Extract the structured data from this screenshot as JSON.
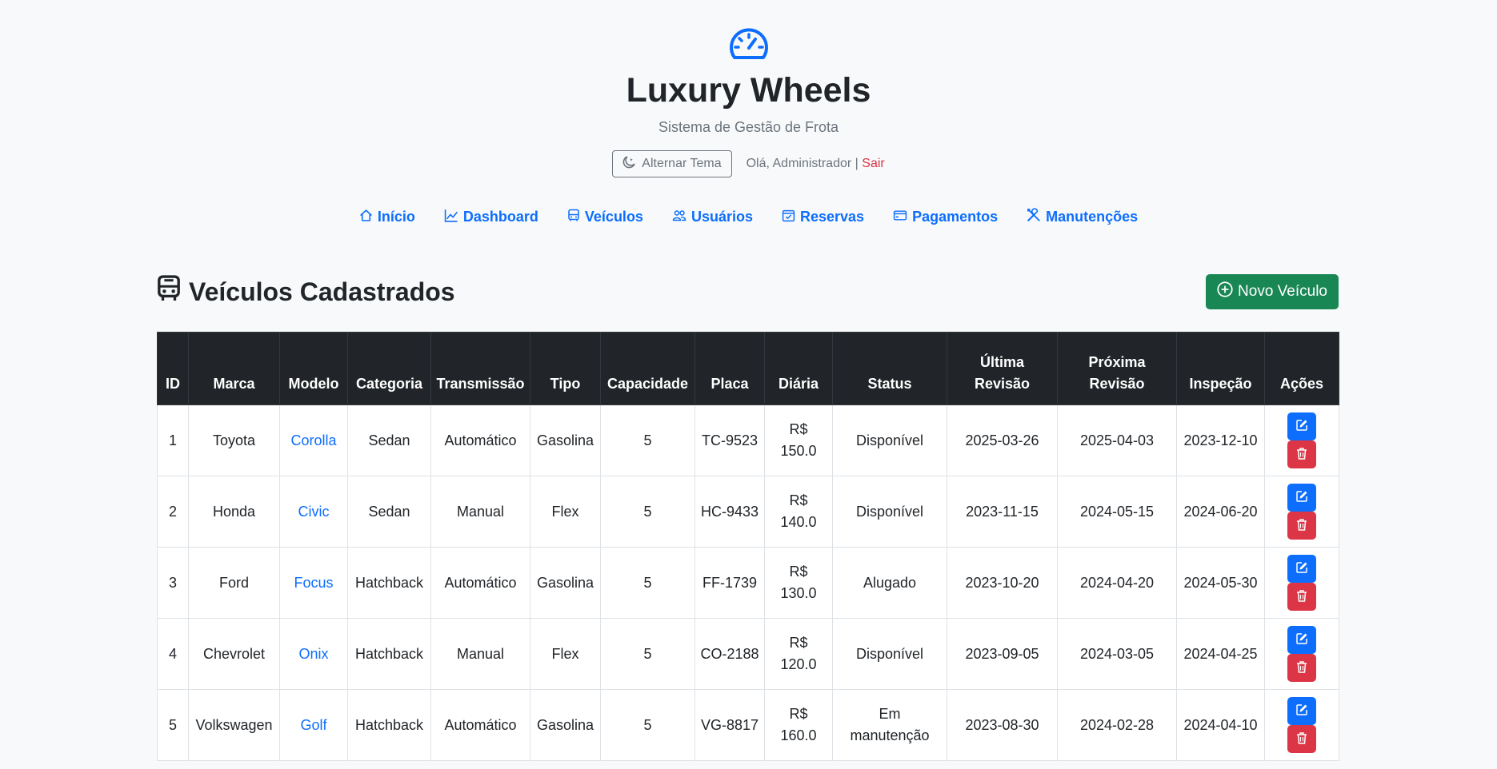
{
  "app": {
    "title": "Luxury Wheels",
    "subtitle": "Sistema de Gestão de Frota",
    "theme_toggle": "Alternar Tema",
    "greeting": "Olá, Administrador",
    "separator": "|",
    "logout": "Sair",
    "logo_icon": "speedometer-icon"
  },
  "nav": [
    {
      "label": "Início",
      "icon": "house-icon"
    },
    {
      "label": "Dashboard",
      "icon": "graph-icon"
    },
    {
      "label": "Veículos",
      "icon": "bus-icon"
    },
    {
      "label": "Usuários",
      "icon": "people-icon"
    },
    {
      "label": "Reservas",
      "icon": "calendar-check-icon"
    },
    {
      "label": "Pagamentos",
      "icon": "credit-card-icon"
    },
    {
      "label": "Manutenções",
      "icon": "tools-icon"
    }
  ],
  "page": {
    "title": "Veículos Cadastrados",
    "new_button": "Novo Veículo"
  },
  "table": {
    "columns": [
      "ID",
      "Marca",
      "Modelo",
      "Categoria",
      "Transmissão",
      "Tipo",
      "Capacidade",
      "Placa",
      "Diária",
      "Status",
      "Última Revisão",
      "Próxima Revisão",
      "Inspeção",
      "Ações"
    ],
    "rows": [
      {
        "id": "1",
        "marca": "Toyota",
        "modelo": "Corolla",
        "categoria": "Sedan",
        "transmissao": "Automático",
        "tipo": "Gasolina",
        "capacidade": "5",
        "placa": "TC-9523",
        "diaria": "R$ 150.0",
        "status": "Disponível",
        "ultima": "2025-03-26",
        "proxima": "2025-04-03",
        "inspecao": "2023-12-10"
      },
      {
        "id": "2",
        "marca": "Honda",
        "modelo": "Civic",
        "categoria": "Sedan",
        "transmissao": "Manual",
        "tipo": "Flex",
        "capacidade": "5",
        "placa": "HC-9433",
        "diaria": "R$ 140.0",
        "status": "Disponível",
        "ultima": "2023-11-15",
        "proxima": "2024-05-15",
        "inspecao": "2024-06-20"
      },
      {
        "id": "3",
        "marca": "Ford",
        "modelo": "Focus",
        "categoria": "Hatchback",
        "transmissao": "Automático",
        "tipo": "Gasolina",
        "capacidade": "5",
        "placa": "FF-1739",
        "diaria": "R$ 130.0",
        "status": "Alugado",
        "ultima": "2023-10-20",
        "proxima": "2024-04-20",
        "inspecao": "2024-05-30"
      },
      {
        "id": "4",
        "marca": "Chevrolet",
        "modelo": "Onix",
        "categoria": "Hatchback",
        "transmissao": "Manual",
        "tipo": "Flex",
        "capacidade": "5",
        "placa": "CO-2188",
        "diaria": "R$ 120.0",
        "status": "Disponível",
        "ultima": "2023-09-05",
        "proxima": "2024-03-05",
        "inspecao": "2024-04-25"
      },
      {
        "id": "5",
        "marca": "Volkswagen",
        "modelo": "Golf",
        "categoria": "Hatchback",
        "transmissao": "Automático",
        "tipo": "Gasolina",
        "capacidade": "5",
        "placa": "VG-8817",
        "diaria": "R$ 160.0",
        "status": "Em manutenção",
        "ultima": "2023-08-30",
        "proxima": "2024-02-28",
        "inspecao": "2024-04-10"
      }
    ]
  },
  "colors": {
    "primary": "#0d6efd",
    "success": "#198754",
    "danger": "#dc3545",
    "dark": "#212529"
  }
}
